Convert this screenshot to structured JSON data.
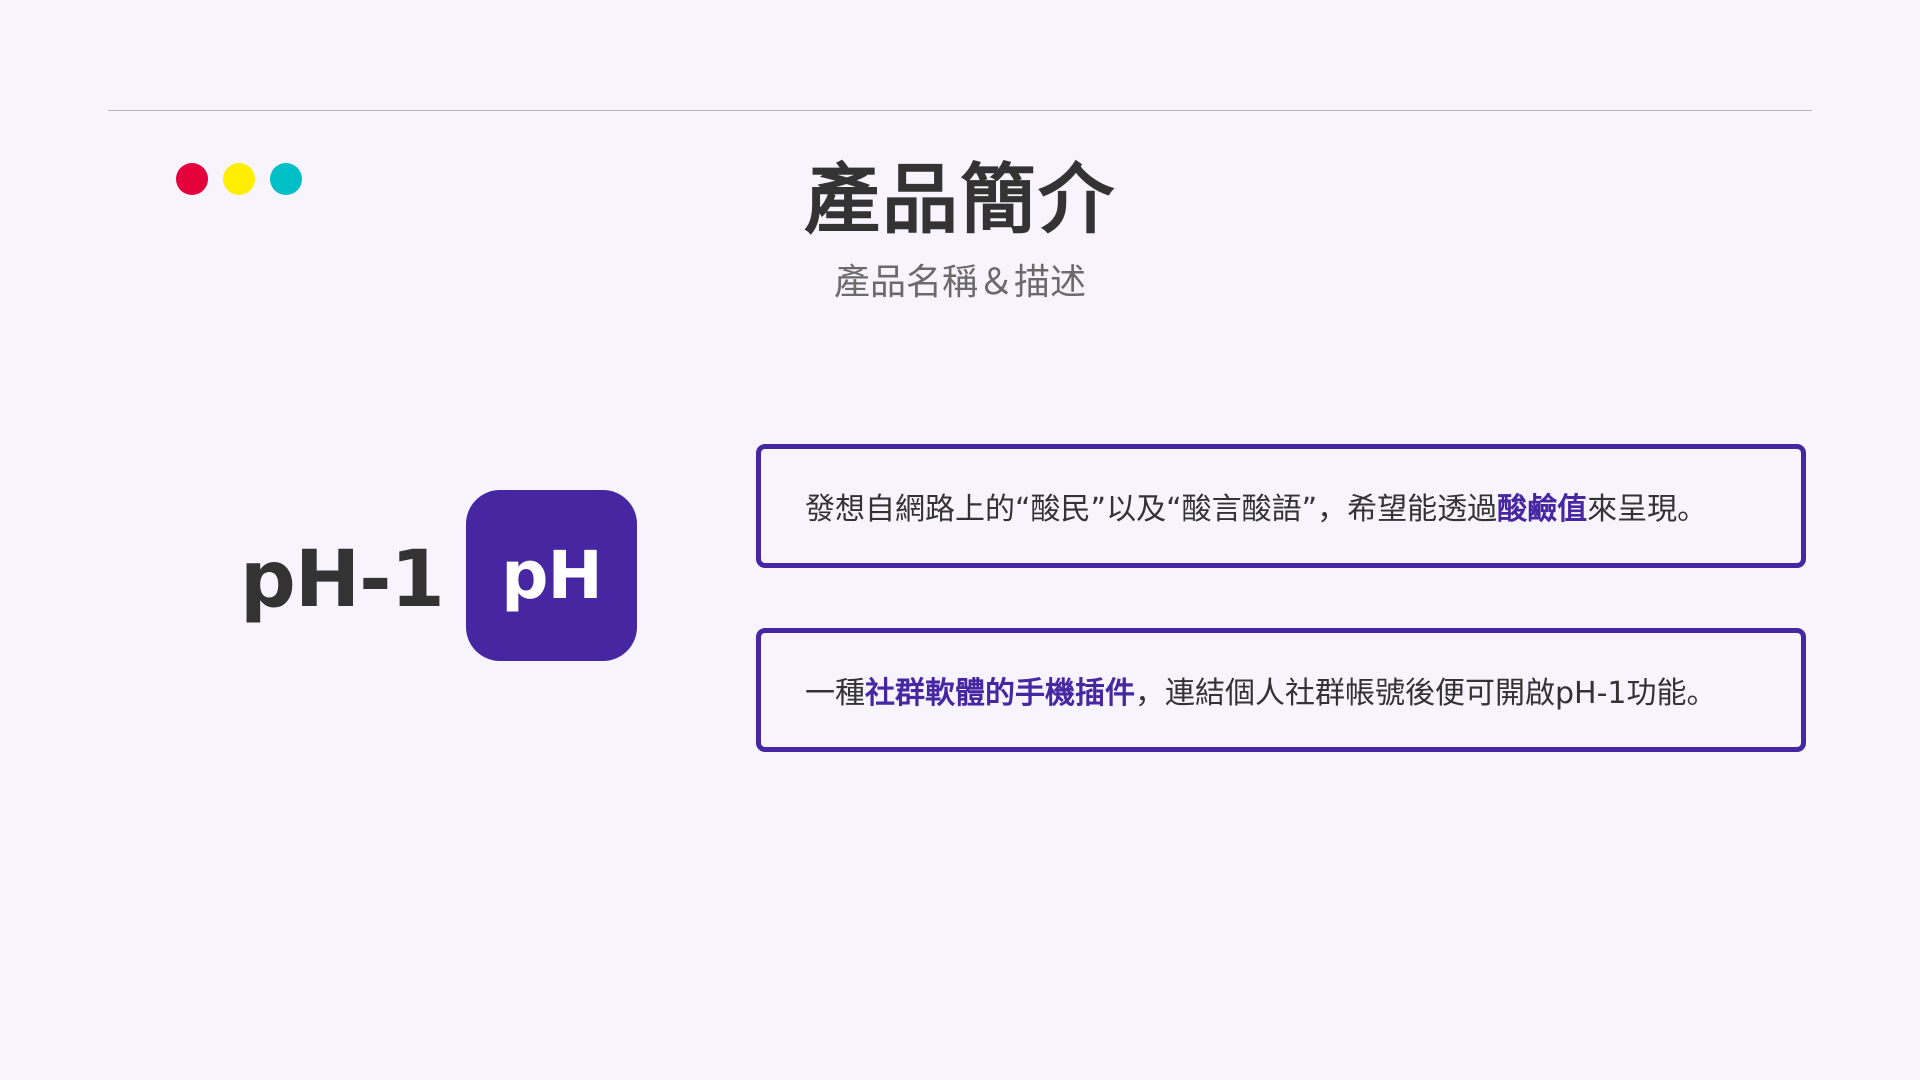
{
  "header": {
    "title": "產品簡介",
    "subtitle": "產品名稱＆描述"
  },
  "decor": {
    "dots": [
      {
        "name": "red-dot",
        "color": "#e4003a"
      },
      {
        "name": "yellow-dot",
        "color": "#ffee00"
      },
      {
        "name": "teal-dot",
        "color": "#00bfc6"
      }
    ]
  },
  "product": {
    "name": "pH-1",
    "logo_text": "pH",
    "logo_color": "#4626a1"
  },
  "descriptions": [
    {
      "before": "發想自網路上的“酸民”以及“酸言酸語”，希望能透過",
      "highlight": "酸鹼值",
      "after": "來呈現。"
    },
    {
      "before": "一種",
      "highlight": "社群軟體的手機插件",
      "after": "，連結個人社群帳號後便可開啟pH-1功能。"
    }
  ],
  "colors": {
    "accent": "#4626a1",
    "background": "#f7f4fe",
    "text": "#333333"
  }
}
